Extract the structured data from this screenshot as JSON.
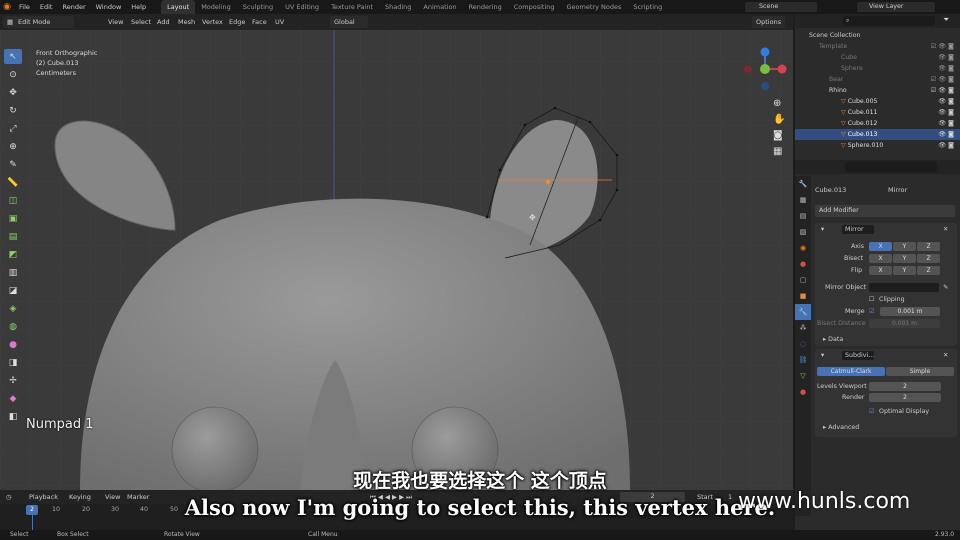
{
  "topbar": {
    "menus": [
      "File",
      "Edit",
      "Render",
      "Window",
      "Help"
    ],
    "workspaces": [
      "Layout",
      "Modeling",
      "Sculpting",
      "UV Editing",
      "Texture Paint",
      "Shading",
      "Animation",
      "Rendering",
      "Compositing",
      "Geometry Nodes",
      "Scripting"
    ],
    "active_workspace": "Layout",
    "scene": "Scene",
    "view_layer": "View Layer"
  },
  "vp_header": {
    "mode": "Edit Mode",
    "menus": [
      "View",
      "Select",
      "Add",
      "Mesh",
      "Vertex",
      "Edge",
      "Face",
      "UV"
    ],
    "orientation": "Global",
    "options": "Options"
  },
  "viewport": {
    "view_name": "Front Orthographic",
    "object": "(2) Cube.013",
    "units": "Centimeters",
    "key_hint": "Numpad 1"
  },
  "outliner": {
    "root": "Scene Collection",
    "rows": [
      {
        "label": "Template",
        "dim": true
      },
      {
        "label": "Cube",
        "dim": true
      },
      {
        "label": "Sphere",
        "dim": true
      },
      {
        "label": "Bear",
        "dim": true
      },
      {
        "label": "Rhino",
        "dim": false
      },
      {
        "label": "Cube.005",
        "dim": false
      },
      {
        "label": "Cube.011",
        "dim": false
      },
      {
        "label": "Cube.012",
        "dim": false
      },
      {
        "label": "Cube.013",
        "dim": false,
        "selected": true
      },
      {
        "label": "Sphere.010",
        "dim": false
      }
    ]
  },
  "properties": {
    "object": "Cube.013",
    "modifier_name": "Mirror",
    "add_modifier": "Add Modifier",
    "mirror": {
      "title": "Mirror",
      "axis_label": "Axis",
      "bisect_label": "Bisect",
      "flip_label": "Flip",
      "x": "X",
      "y": "Y",
      "z": "Z",
      "mirror_object": "Mirror Object",
      "clipping": "Clipping",
      "merge": "Merge",
      "merge_value": "0.001 m",
      "bisect_distance": "Bisect Distance",
      "bisect_distance_value": "0.001 m",
      "data": "Data"
    },
    "subdiv": {
      "title": "Subdivi...",
      "catmull": "Catmull-Clark",
      "simple": "Simple",
      "levels_viewport": "Levels Viewport",
      "levels_value": "2",
      "render": "Render",
      "render_value": "2",
      "optimal": "Optimal Display",
      "advanced": "Advanced"
    }
  },
  "timeline": {
    "menus": [
      "Playback",
      "Keying",
      "View",
      "Marker"
    ],
    "current_frame": "2",
    "start_label": "Start",
    "start_value": "1",
    "ticks": [
      "2",
      "10",
      "20",
      "30",
      "40",
      "50"
    ]
  },
  "statusbar": {
    "items": [
      "Select",
      "Box Select",
      "Rotate View",
      "Call Menu"
    ],
    "version": "2.93.0"
  },
  "subtitles": {
    "cn": "现在我也要选择这个 这个顶点",
    "en": "Also now I'm going to select this, this vertex here."
  },
  "watermark": "www.hunls.com",
  "colors": {
    "accent": "#4772b3",
    "mesh": "#8a8a8a",
    "bg": "#3a3a3a"
  }
}
